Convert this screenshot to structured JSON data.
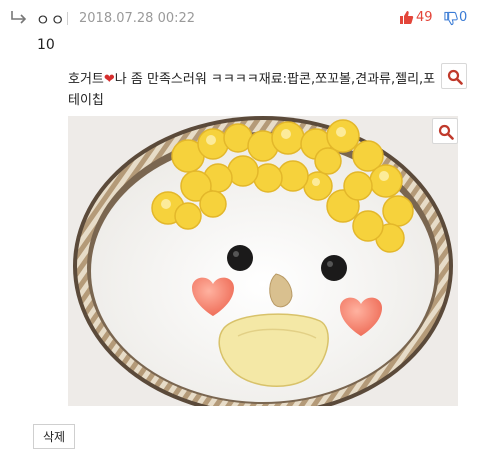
{
  "comment": {
    "author": "ㅇㅇ",
    "timestamp": "2018.07.28 00:22",
    "upvotes": "49",
    "downvotes": "0",
    "body": "10",
    "caption_before_heart": "호거트",
    "caption_heart": "❤",
    "caption_after_heart": "나 좀 만족스러워 ㅋㅋㅋㅋ재료:팝콘,쪼꼬볼,견과류,젤리,포테이칩",
    "delete_label": "삭제"
  },
  "colors": {
    "upvote": "#e3453a",
    "downvote": "#3a7bd5",
    "timestamp": "#9a9a9a"
  },
  "icons": {
    "reply": "reply-arrow-icon",
    "upvote": "thumbs-up-icon",
    "downvote": "thumbs-down-icon",
    "zoom": "magnifier-icon"
  }
}
